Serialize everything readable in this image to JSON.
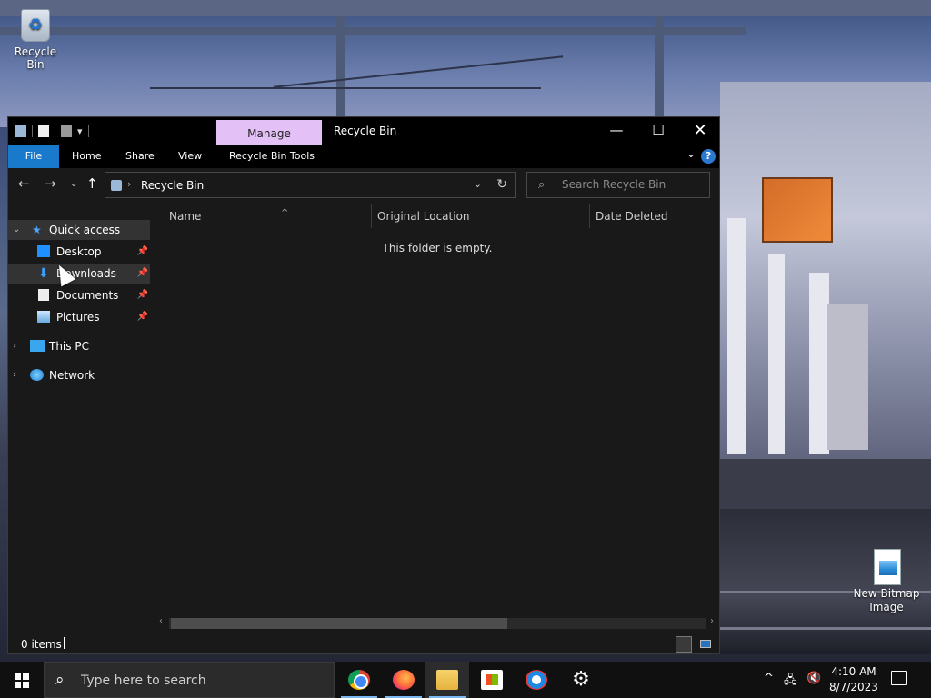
{
  "desktop": {
    "icons": [
      {
        "label": "Recycle Bin"
      },
      {
        "label": "New Bitmap Image"
      }
    ]
  },
  "window": {
    "title": "Recycle Bin",
    "contextual_tab": "Manage",
    "ribbon_tabs": [
      "File",
      "Home",
      "Share",
      "View",
      "Recycle Bin Tools"
    ],
    "address": {
      "path": "Recycle Bin"
    },
    "search": {
      "placeholder": "Search Recycle Bin"
    },
    "nav": {
      "quick_access": "Quick access",
      "items": [
        {
          "label": "Desktop",
          "pinned": true
        },
        {
          "label": "Downloads",
          "pinned": true
        },
        {
          "label": "Documents",
          "pinned": true
        },
        {
          "label": "Pictures",
          "pinned": true
        }
      ],
      "this_pc": "This PC",
      "network": "Network"
    },
    "columns": [
      "Name",
      "Original Location",
      "Date Deleted"
    ],
    "empty_message": "This folder is empty.",
    "status": "0 items"
  },
  "taskbar": {
    "search_placeholder": "Type here to search",
    "apps": [
      "chrome-icon",
      "firefox-icon",
      "file-explorer-icon",
      "store-icon",
      "vpn-icon",
      "settings-icon"
    ],
    "clock": {
      "time": "4:10 AM",
      "date": "8/7/2023"
    }
  },
  "colors": {
    "accent": "#1979ca",
    "manage_tab": "#e3c0f5",
    "window_bg": "#191919"
  }
}
